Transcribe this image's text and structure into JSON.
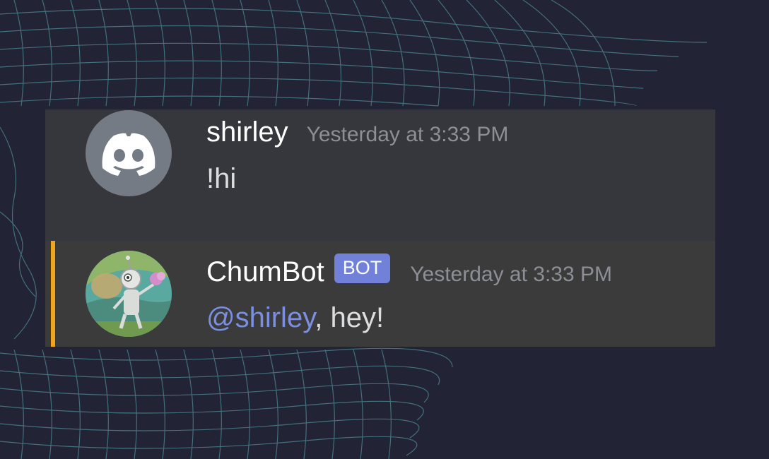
{
  "messages": [
    {
      "username": "shirley",
      "timestamp": "Yesterday at 3:33 PM",
      "text": "!hi",
      "avatar_icon": "discord-logo-icon",
      "avatar_color": "#757b85"
    },
    {
      "username": "ChumBot",
      "badge": "BOT",
      "timestamp": "Yesterday at 3:33 PM",
      "mention": "@shirley",
      "text_after_mention": ", hey!",
      "avatar_icon": "robot-cartoon-avatar",
      "highlight_color": "#f0a51c",
      "badge_color": "#7181d9"
    }
  ]
}
